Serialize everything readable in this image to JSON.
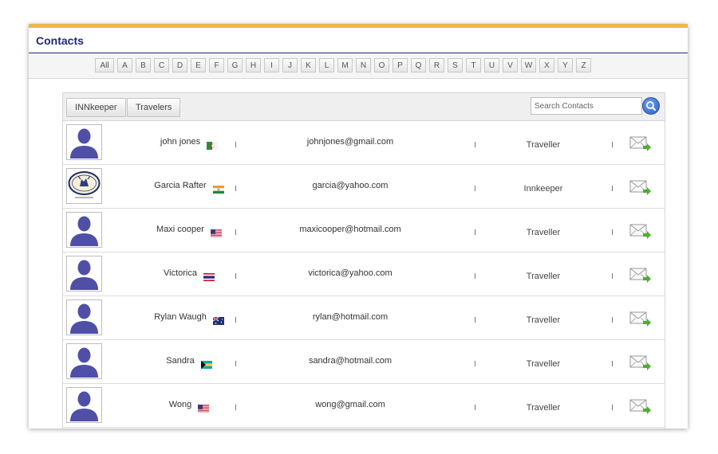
{
  "page": {
    "title": "Contacts"
  },
  "letters": [
    "All",
    "A",
    "B",
    "C",
    "D",
    "E",
    "F",
    "G",
    "H",
    "I",
    "J",
    "K",
    "L",
    "M",
    "N",
    "O",
    "P",
    "Q",
    "R",
    "S",
    "T",
    "U",
    "V",
    "W",
    "X",
    "Y",
    "Z"
  ],
  "toolbar": {
    "innkeeper_label": "INNkeeper",
    "travelers_label": "Travelers",
    "search_placeholder": "Search Contacts"
  },
  "contacts": [
    {
      "name": "john jones",
      "flag": "algeria",
      "email": "johnjones@gmail.com",
      "type": "Traveller",
      "avatar": "silhouette"
    },
    {
      "name": "Garcia Rafter",
      "flag": "india",
      "email": "garcia@yahoo.com",
      "type": "Innkeeper",
      "avatar": "logo"
    },
    {
      "name": "Maxi cooper",
      "flag": "usa",
      "email": "maxicooper@hotmail.com",
      "type": "Traveller",
      "avatar": "silhouette"
    },
    {
      "name": "Victorica",
      "flag": "thailand",
      "email": "victorica@yahoo.com",
      "type": "Traveller",
      "avatar": "silhouette"
    },
    {
      "name": "Rylan Waugh",
      "flag": "australia",
      "email": "rylan@hotmail.com",
      "type": "Traveller",
      "avatar": "silhouette"
    },
    {
      "name": "Sandra",
      "flag": "bahamas",
      "email": "sandra@hotmail.com",
      "type": "Traveller",
      "avatar": "silhouette"
    },
    {
      "name": "Wong",
      "flag": "usa",
      "email": "wong@gmail.com",
      "type": "Traveller",
      "avatar": "silhouette"
    }
  ],
  "colors": {
    "accent_bar": "#e9b949",
    "title": "#1e2a78",
    "avatar": "#4f4fa8",
    "mail_arrow": "#4caf2a"
  },
  "icons": {
    "search": "search-icon",
    "mail": "send-message-icon",
    "avatar": "user-silhouette-icon"
  }
}
